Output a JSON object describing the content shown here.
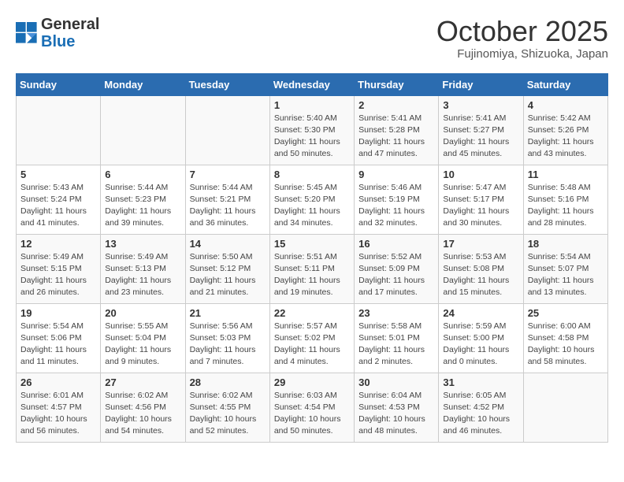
{
  "header": {
    "logo_general": "General",
    "logo_blue": "Blue",
    "month": "October 2025",
    "location": "Fujinomiya, Shizuoka, Japan"
  },
  "weekdays": [
    "Sunday",
    "Monday",
    "Tuesday",
    "Wednesday",
    "Thursday",
    "Friday",
    "Saturday"
  ],
  "weeks": [
    [
      {
        "day": "",
        "info": ""
      },
      {
        "day": "",
        "info": ""
      },
      {
        "day": "",
        "info": ""
      },
      {
        "day": "1",
        "info": "Sunrise: 5:40 AM\nSunset: 5:30 PM\nDaylight: 11 hours\nand 50 minutes."
      },
      {
        "day": "2",
        "info": "Sunrise: 5:41 AM\nSunset: 5:28 PM\nDaylight: 11 hours\nand 47 minutes."
      },
      {
        "day": "3",
        "info": "Sunrise: 5:41 AM\nSunset: 5:27 PM\nDaylight: 11 hours\nand 45 minutes."
      },
      {
        "day": "4",
        "info": "Sunrise: 5:42 AM\nSunset: 5:26 PM\nDaylight: 11 hours\nand 43 minutes."
      }
    ],
    [
      {
        "day": "5",
        "info": "Sunrise: 5:43 AM\nSunset: 5:24 PM\nDaylight: 11 hours\nand 41 minutes."
      },
      {
        "day": "6",
        "info": "Sunrise: 5:44 AM\nSunset: 5:23 PM\nDaylight: 11 hours\nand 39 minutes."
      },
      {
        "day": "7",
        "info": "Sunrise: 5:44 AM\nSunset: 5:21 PM\nDaylight: 11 hours\nand 36 minutes."
      },
      {
        "day": "8",
        "info": "Sunrise: 5:45 AM\nSunset: 5:20 PM\nDaylight: 11 hours\nand 34 minutes."
      },
      {
        "day": "9",
        "info": "Sunrise: 5:46 AM\nSunset: 5:19 PM\nDaylight: 11 hours\nand 32 minutes."
      },
      {
        "day": "10",
        "info": "Sunrise: 5:47 AM\nSunset: 5:17 PM\nDaylight: 11 hours\nand 30 minutes."
      },
      {
        "day": "11",
        "info": "Sunrise: 5:48 AM\nSunset: 5:16 PM\nDaylight: 11 hours\nand 28 minutes."
      }
    ],
    [
      {
        "day": "12",
        "info": "Sunrise: 5:49 AM\nSunset: 5:15 PM\nDaylight: 11 hours\nand 26 minutes."
      },
      {
        "day": "13",
        "info": "Sunrise: 5:49 AM\nSunset: 5:13 PM\nDaylight: 11 hours\nand 23 minutes."
      },
      {
        "day": "14",
        "info": "Sunrise: 5:50 AM\nSunset: 5:12 PM\nDaylight: 11 hours\nand 21 minutes."
      },
      {
        "day": "15",
        "info": "Sunrise: 5:51 AM\nSunset: 5:11 PM\nDaylight: 11 hours\nand 19 minutes."
      },
      {
        "day": "16",
        "info": "Sunrise: 5:52 AM\nSunset: 5:09 PM\nDaylight: 11 hours\nand 17 minutes."
      },
      {
        "day": "17",
        "info": "Sunrise: 5:53 AM\nSunset: 5:08 PM\nDaylight: 11 hours\nand 15 minutes."
      },
      {
        "day": "18",
        "info": "Sunrise: 5:54 AM\nSunset: 5:07 PM\nDaylight: 11 hours\nand 13 minutes."
      }
    ],
    [
      {
        "day": "19",
        "info": "Sunrise: 5:54 AM\nSunset: 5:06 PM\nDaylight: 11 hours\nand 11 minutes."
      },
      {
        "day": "20",
        "info": "Sunrise: 5:55 AM\nSunset: 5:04 PM\nDaylight: 11 hours\nand 9 minutes."
      },
      {
        "day": "21",
        "info": "Sunrise: 5:56 AM\nSunset: 5:03 PM\nDaylight: 11 hours\nand 7 minutes."
      },
      {
        "day": "22",
        "info": "Sunrise: 5:57 AM\nSunset: 5:02 PM\nDaylight: 11 hours\nand 4 minutes."
      },
      {
        "day": "23",
        "info": "Sunrise: 5:58 AM\nSunset: 5:01 PM\nDaylight: 11 hours\nand 2 minutes."
      },
      {
        "day": "24",
        "info": "Sunrise: 5:59 AM\nSunset: 5:00 PM\nDaylight: 11 hours\nand 0 minutes."
      },
      {
        "day": "25",
        "info": "Sunrise: 6:00 AM\nSunset: 4:58 PM\nDaylight: 10 hours\nand 58 minutes."
      }
    ],
    [
      {
        "day": "26",
        "info": "Sunrise: 6:01 AM\nSunset: 4:57 PM\nDaylight: 10 hours\nand 56 minutes."
      },
      {
        "day": "27",
        "info": "Sunrise: 6:02 AM\nSunset: 4:56 PM\nDaylight: 10 hours\nand 54 minutes."
      },
      {
        "day": "28",
        "info": "Sunrise: 6:02 AM\nSunset: 4:55 PM\nDaylight: 10 hours\nand 52 minutes."
      },
      {
        "day": "29",
        "info": "Sunrise: 6:03 AM\nSunset: 4:54 PM\nDaylight: 10 hours\nand 50 minutes."
      },
      {
        "day": "30",
        "info": "Sunrise: 6:04 AM\nSunset: 4:53 PM\nDaylight: 10 hours\nand 48 minutes."
      },
      {
        "day": "31",
        "info": "Sunrise: 6:05 AM\nSunset: 4:52 PM\nDaylight: 10 hours\nand 46 minutes."
      },
      {
        "day": "",
        "info": ""
      }
    ]
  ]
}
